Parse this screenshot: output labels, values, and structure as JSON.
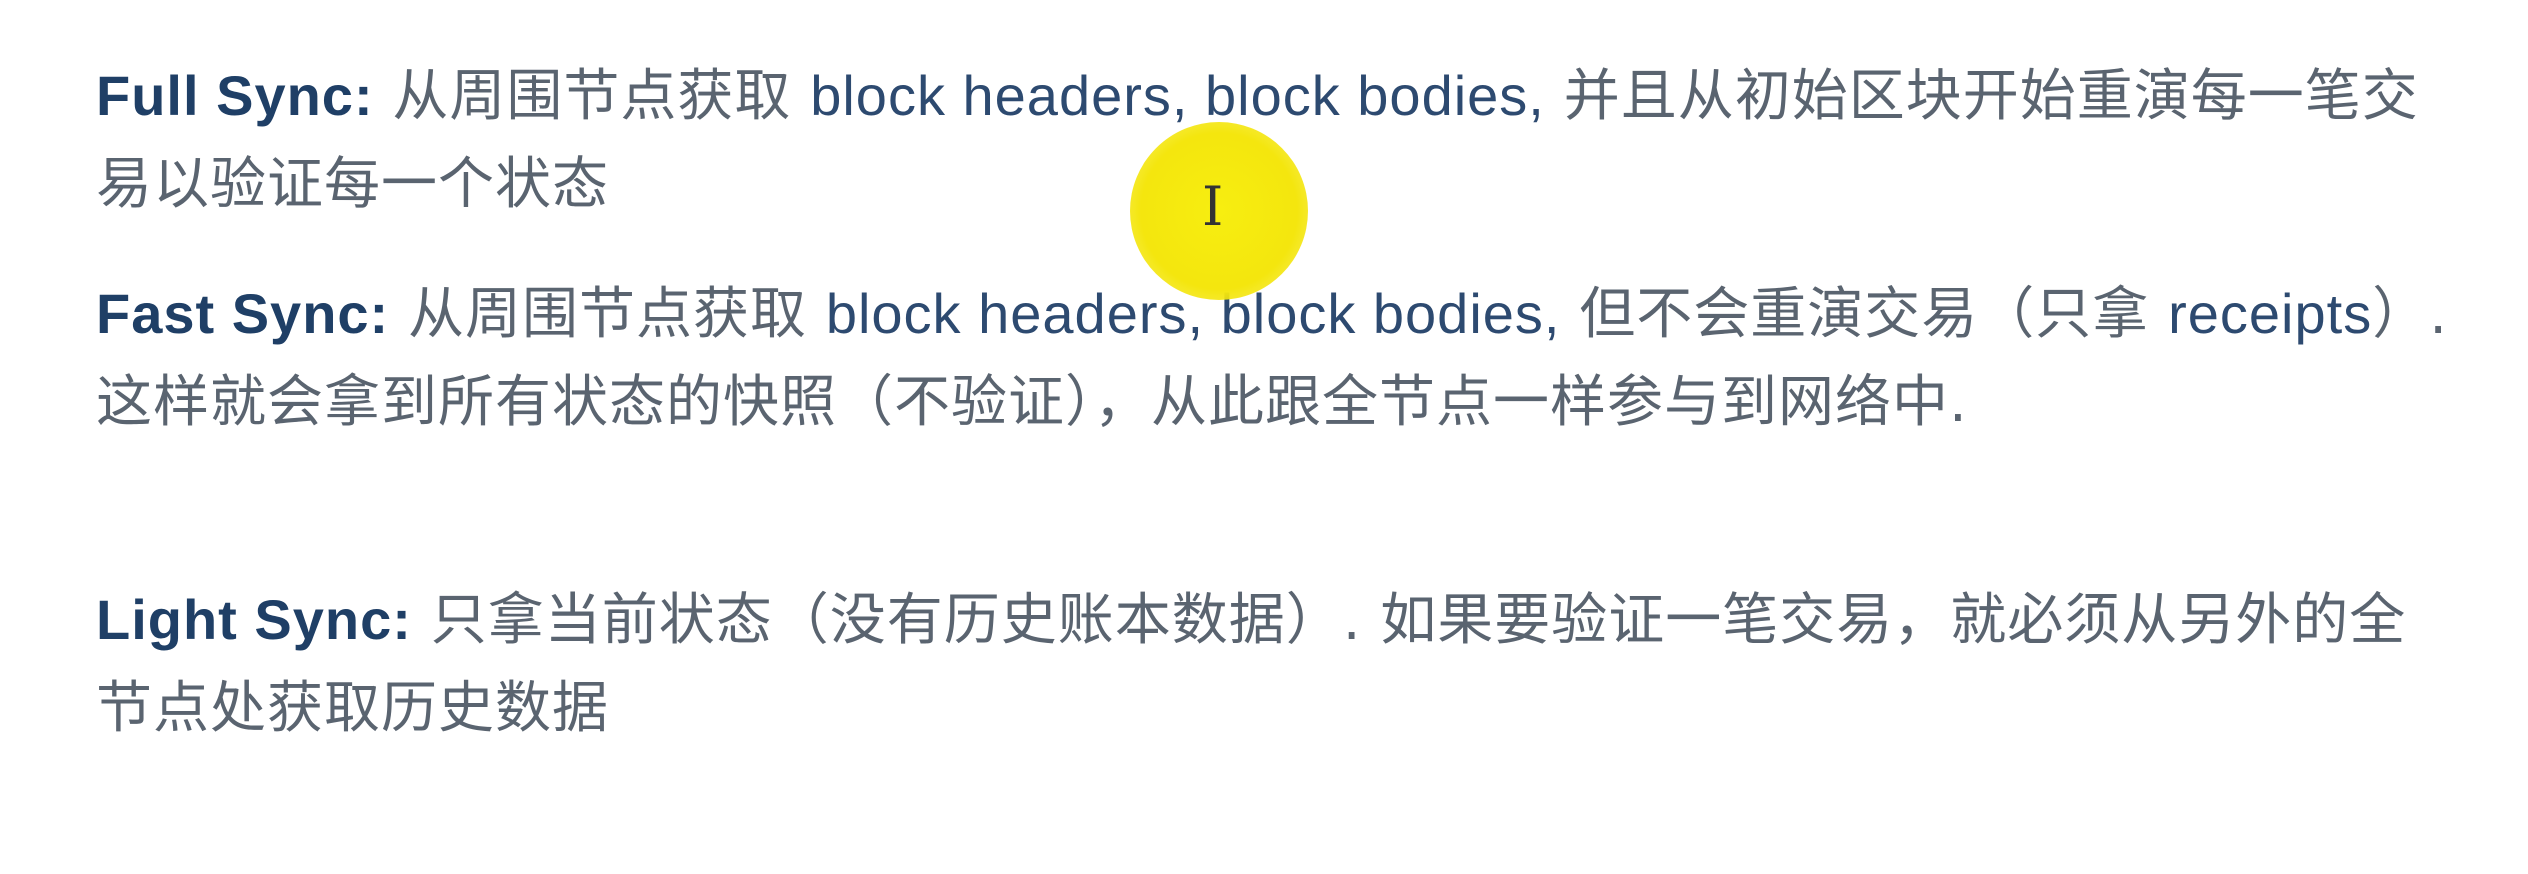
{
  "sections": [
    {
      "term": "Full Sync:",
      "parts": [
        "从周围节点获取",
        "block headers, block bodies,",
        "并且从初始区块开始重演每一笔交易以验证每一个状态"
      ]
    },
    {
      "term": "Fast Sync:",
      "parts": [
        "从周围节点获取",
        "block headers, block bodies,",
        "但不会重演交易（只拿",
        "receipts",
        "）. 这样就会拿到所有状态的快照（不验证），从此跟全节点一样参与到网络中."
      ]
    },
    {
      "term": "Light Sync:",
      "parts": [
        "只拿当前状态（没有历史账本数据）. 如果要验证一笔交易，就必须从另外的全节点处获取历史数据"
      ]
    }
  ],
  "cursor": {
    "glyph": "I",
    "icon": "text-cursor-icon",
    "highlight_color": "#f4e60e"
  }
}
